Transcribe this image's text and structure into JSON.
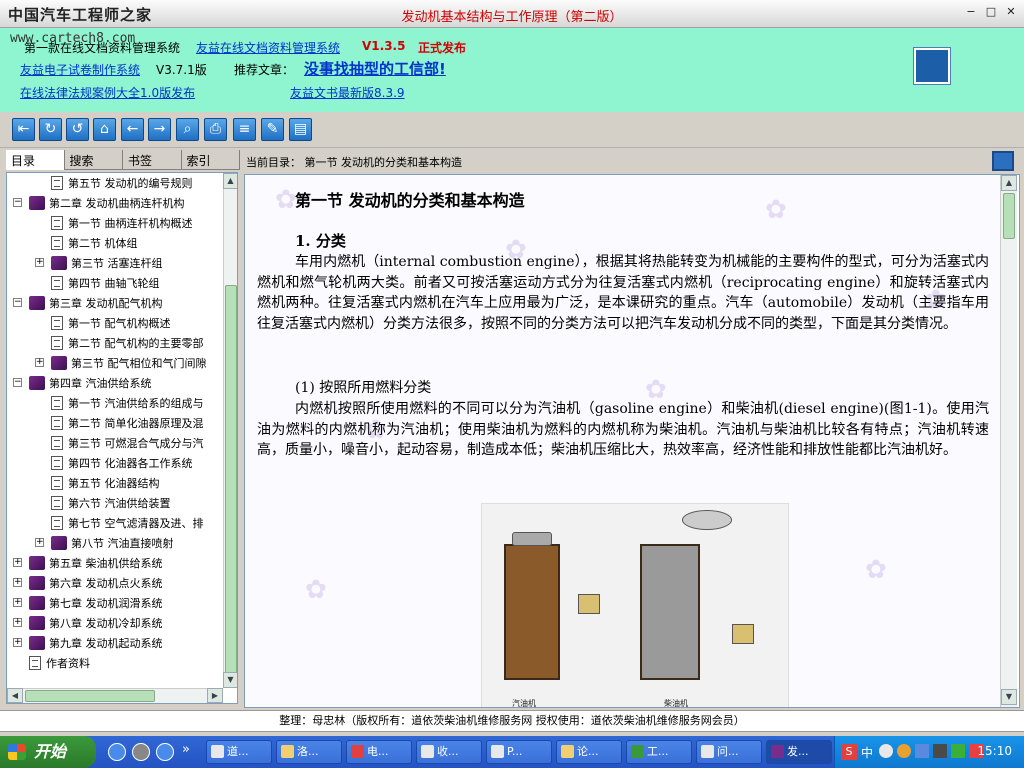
{
  "window": {
    "logo_text": "中国汽车工程师之家",
    "title": "发动机基本结构与工作原理（第二版）"
  },
  "banner": {
    "watermark": "www.cartech8.com",
    "line1_text": "第一款在线文档资料管理系统",
    "line1_link": "友益在线文档资料管理系统",
    "line1_version": "V1.3.5",
    "line1_release": "正式发布",
    "line2_link": "友益电子试卷制作系统",
    "line2_version": "V3.7.1版",
    "line2_recommend": "推荐文章：",
    "line2_article": "没事找抽型的工信部!",
    "line3_link1": "在线法律法规案例大全1.0版发布",
    "line3_link2": "友益文书最新版8.3.9"
  },
  "toolbar": {
    "icons": [
      "exit-icon",
      "refresh-icon",
      "back-refresh-icon",
      "home-icon",
      "back-arrow-icon",
      "forward-arrow-icon",
      "search-icon",
      "print-icon",
      "notes-icon",
      "edit-icon",
      "bookmark-icon"
    ]
  },
  "tabs": [
    "目录",
    "搜索",
    "书签",
    "索引"
  ],
  "tree": [
    {
      "label": "第五节 发动机的编号规则",
      "level": 2,
      "type": "doc"
    },
    {
      "label": "第二章 发动机曲柄连杆机构",
      "level": 1,
      "type": "book",
      "exp": "−"
    },
    {
      "label": "第一节 曲柄连杆机构概述",
      "level": 2,
      "type": "doc"
    },
    {
      "label": "第二节 机体组",
      "level": 2,
      "type": "doc"
    },
    {
      "label": "第三节 活塞连杆组",
      "level": 2,
      "type": "book",
      "exp": "+"
    },
    {
      "label": "第四节 曲轴飞轮组",
      "level": 2,
      "type": "doc"
    },
    {
      "label": "第三章 发动机配气机构",
      "level": 1,
      "type": "book",
      "exp": "−"
    },
    {
      "label": "第一节 配气机构概述",
      "level": 2,
      "type": "doc"
    },
    {
      "label": "第二节 配气机构的主要零部",
      "level": 2,
      "type": "doc"
    },
    {
      "label": "第三节 配气相位和气门间隙",
      "level": 2,
      "type": "book",
      "exp": "+"
    },
    {
      "label": "第四章 汽油供给系统",
      "level": 1,
      "type": "book",
      "exp": "−"
    },
    {
      "label": "第一节 汽油供给系的组成与",
      "level": 2,
      "type": "doc"
    },
    {
      "label": "第二节 简单化油器原理及混",
      "level": 2,
      "type": "doc"
    },
    {
      "label": "第三节 可燃混合气成分与汽",
      "level": 2,
      "type": "doc"
    },
    {
      "label": "第四节 化油器各工作系统",
      "level": 2,
      "type": "doc"
    },
    {
      "label": "第五节 化油器结构",
      "level": 2,
      "type": "doc"
    },
    {
      "label": "第六节 汽油供给装置",
      "level": 2,
      "type": "doc"
    },
    {
      "label": "第七节 空气滤清器及进、排",
      "level": 2,
      "type": "doc"
    },
    {
      "label": "第八节 汽油直接喷射",
      "level": 2,
      "type": "book",
      "exp": "+"
    },
    {
      "label": "第五章 柴油机供给系统",
      "level": 1,
      "type": "book",
      "exp": "+"
    },
    {
      "label": "第六章 发动机点火系统",
      "level": 1,
      "type": "book",
      "exp": "+"
    },
    {
      "label": "第七章 发动机润滑系统",
      "level": 1,
      "type": "book",
      "exp": "+"
    },
    {
      "label": "第八章 发动机冷却系统",
      "level": 1,
      "type": "book",
      "exp": "+"
    },
    {
      "label": "第九章 发动机起动系统",
      "level": 1,
      "type": "book",
      "exp": "+"
    },
    {
      "label": "作者资料",
      "level": 1,
      "type": "doc"
    }
  ],
  "current_dir": "当前目录： 第一节 发动机的分类和基本构造",
  "content": {
    "title": "第一节 发动机的分类和基本构造",
    "section": "1. 分类",
    "para1": "车用内燃机（internal combustion engine），根据其将热能转变为机械能的主要构件的型式，可分为活塞式内燃机和燃气轮机两大类。前者又可按活塞运动方式分为往复活塞式内燃机（reciprocating engine）和旋转活塞式内燃机两种。往复活塞式内燃机在汽车上应用最为广泛，是本课研究的重点。汽车（automobile）发动机（主要指车用往复活塞式内燃机）分类方法很多，按照不同的分类方法可以把汽车发动机分成不同的类型，下面是其分类情况。",
    "sub": "(1) 按照所用燃料分类",
    "para2": "内燃机按照所使用燃料的不同可以分为汽油机（gasoline engine）和柴油机(diesel engine)(图1-1)。使用汽油为燃料的内燃机称为汽油机；使用柴油机为燃料的内燃机称为柴油机。汽油机与柴油机比较各有特点；汽油机转速高，质量小，噪音小，起动容易，制造成本低；柴油机压缩比大，热效率高，经济性能和排放性能都比汽油机好。",
    "cap_left": "汽油机",
    "cap_right": "柴油机"
  },
  "status": "整理：母忠林（版权所有：道依茨柴油机维修服务网  授权使用：道依茨柴油机维修服务网会员）",
  "taskbar": {
    "start": "开始",
    "tasks": [
      "道...",
      "洛...",
      "电...",
      "收...",
      "P...",
      "论...",
      "工...",
      "问...",
      "发..."
    ],
    "clock": "15:10",
    "tray_lang": "中"
  }
}
